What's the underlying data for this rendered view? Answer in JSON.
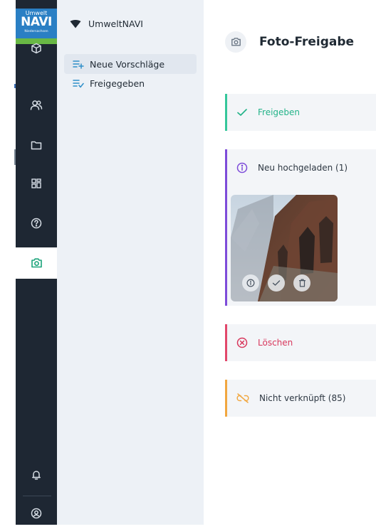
{
  "app": {
    "logo": {
      "top": "Umwelt",
      "main": "NAVI",
      "sub": "Niedersachsen"
    }
  },
  "rail": {
    "items": [
      {
        "icon": "cube-icon",
        "name": "Module"
      },
      {
        "icon": "users-icon",
        "name": "Users"
      },
      {
        "icon": "folder-icon",
        "name": "Folders"
      },
      {
        "icon": "dashboard-icon",
        "name": "Dashboard"
      },
      {
        "icon": "help-icon",
        "name": "Help"
      },
      {
        "icon": "camera-icon",
        "name": "Photo",
        "active": true
      }
    ],
    "bottom": [
      {
        "icon": "bell-icon"
      },
      {
        "icon": "user-circle-icon"
      }
    ]
  },
  "subnav": {
    "title": "UmweltNAVI",
    "items": [
      {
        "label": "Neue Vorschläge",
        "active": true
      },
      {
        "label": "Freigegeben",
        "active": false
      }
    ]
  },
  "main": {
    "title": "Foto-Freigabe",
    "sections": {
      "approve": "Freigeben",
      "new_uploaded": "Neu hochgeladen (1)",
      "delete": "Löschen",
      "not_linked": "Nicht verknüpft (85)"
    }
  },
  "colors": {
    "rail_bg": "#1e2733",
    "subnav_bg": "#edf1f6",
    "accent_green": "#35c79a",
    "accent_purple": "#7d4bd9",
    "accent_red": "#e2476a",
    "accent_orange": "#f1a740"
  }
}
